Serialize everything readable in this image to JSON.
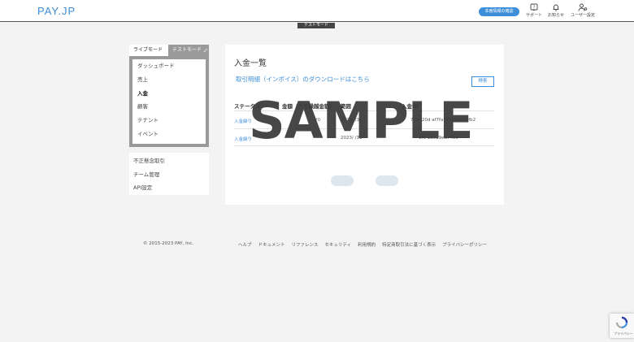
{
  "header": {
    "logo": "PAY.JP",
    "confirm_button": "本番情報の確認",
    "support": "サポート",
    "notifications": "お知らせ",
    "user_settings": "ユーザー設定",
    "test_mode_banner": "テストモード"
  },
  "sidebar": {
    "live_mode": "ライブモード",
    "test_mode": "テストモード",
    "items": [
      "ダッシュボード",
      "売上",
      "入金",
      "顧客",
      "テナント",
      "イベント"
    ],
    "active_item": "入金",
    "items2": [
      "不正懸念取引",
      "チーム管理",
      "API設定"
    ]
  },
  "main": {
    "title": "入金一覧",
    "invoice_link": "取引明細（インボイス）のダウンロードはこちら",
    "search_button": "検索",
    "columns": [
      "ステータス",
      "金額（うち繰越金額）",
      "範囲",
      "入金ID"
    ],
    "rows": [
      {
        "status": "入金繰り",
        "amount": "¥0",
        "range": "2023/  /31",
        "id": "729620d  af7fa788be8c8dfb2"
      },
      {
        "status": "入金繰り",
        "amount": "",
        "range": "2023/  /31",
        "id": "1f6  1d919ed740e"
      }
    ]
  },
  "watermark": "SAMPLE",
  "footer": {
    "copyright": "© 2015-2023 PAY, Inc.",
    "links": [
      "ヘルプ",
      "ドキュメント",
      "リファレンス",
      "セキュリティ",
      "利用規約",
      "特定商取引法に基づく表示",
      "プライバシーポリシー"
    ]
  },
  "recaptcha": {
    "text": "プライバシー"
  },
  "colors": {
    "accent": "#3d8ed8",
    "sidebar_border": "#9a9a9a",
    "background": "#f3f3f3"
  }
}
